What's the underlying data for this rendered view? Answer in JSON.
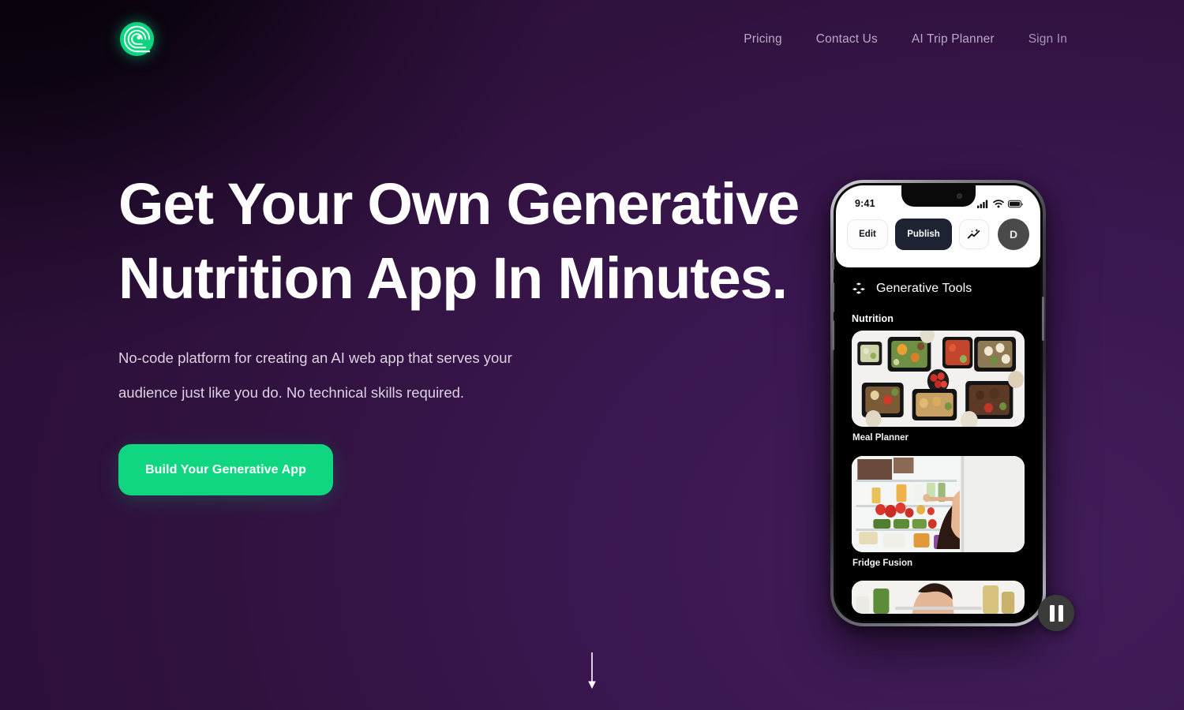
{
  "brand": {
    "logo_icon": "spiral-wave-logo-icon",
    "accent_color": "#10d682"
  },
  "nav": {
    "items": [
      {
        "label": "Pricing"
      },
      {
        "label": "Contact Us"
      },
      {
        "label": "AI Trip Planner"
      },
      {
        "label": "Sign In"
      }
    ]
  },
  "hero": {
    "title_line1": "Get Your Own Generative",
    "title_line2": "Nutrition App In Minutes.",
    "subtitle_line1": "No-code platform for creating an AI web app that serves your",
    "subtitle_line2": "audience just like you do. No technical skills required.",
    "cta_label": "Build Your Generative App",
    "scroll_icon": "scroll-down-arrow-icon"
  },
  "phone": {
    "status": {
      "time": "9:41",
      "signal_icon": "cellular-signal-icon",
      "wifi_icon": "wifi-icon",
      "battery_icon": "battery-icon"
    },
    "actions": {
      "edit_label": "Edit",
      "publish_label": "Publish",
      "ai_icon": "sparkle-trending-icon",
      "avatar_initial": "D"
    },
    "tools": {
      "icon": "blocks-cubes-icon",
      "title": "Generative Tools"
    },
    "section_label": "Nutrition",
    "cards": [
      {
        "label": "Meal Planner",
        "media": "meal-trays-photo"
      },
      {
        "label": "Fridge Fusion",
        "media": "woman-at-fridge-photo"
      },
      {
        "label": "",
        "media": "third-card-partial-photo"
      }
    ],
    "pause_icon": "pause-button-icon"
  }
}
